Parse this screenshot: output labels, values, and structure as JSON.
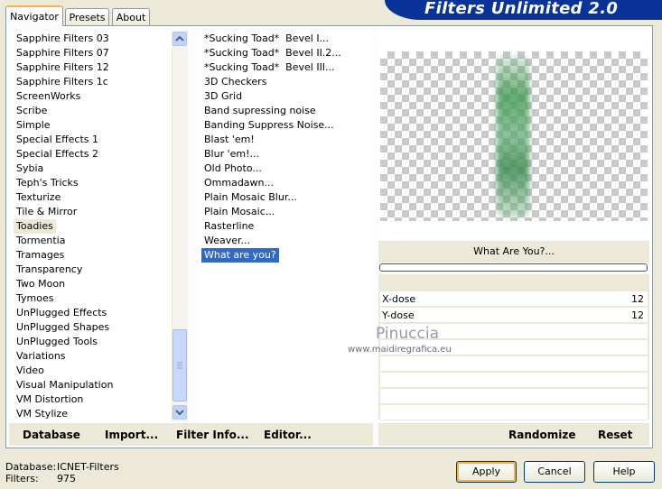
{
  "tabs": [
    "Navigator",
    "Presets",
    "About"
  ],
  "app_title": "Filters Unlimited 2.0",
  "categories": [
    "Sapphire Filters 03",
    "Sapphire Filters 07",
    "Sapphire Filters 12",
    "Sapphire Filters 1c",
    "ScreenWorks",
    "Scribe",
    "Simple",
    "Special Effects 1",
    "Special Effects 2",
    "Sybia",
    "Teph's Tricks",
    "Texturize",
    "Tile & Mirror",
    "Toadies",
    "Tormentia",
    "Tramages",
    "Transparency",
    "Two Moon",
    "Tymoes",
    "UnPlugged Effects",
    "UnPlugged Shapes",
    "UnPlugged Tools",
    "Variations",
    "Video",
    "Visual Manipulation",
    "VM Distortion",
    "VM Stylize"
  ],
  "selected_category": "Toadies",
  "filters": [
    "*Sucking Toad*  Bevel I...",
    "*Sucking Toad*  Bevel II.2...",
    "*Sucking Toad*  Bevel III...",
    "3D Checkers",
    "3D Grid",
    "Band supressing noise",
    "Banding Suppress Noise...",
    "Blast 'em!",
    "Blur 'em!...",
    "Old Photo...",
    "Ommadawn...",
    "Plain Mosaic Blur...",
    "Plain Mosaic...",
    "Rasterline",
    "Weaver...",
    "What are you?"
  ],
  "selected_filter": "What are you?",
  "filter_name": "What Are You?...",
  "params": [
    {
      "label": "X-dose",
      "value": "12"
    },
    {
      "label": "Y-dose",
      "value": "12"
    }
  ],
  "left_buttons": {
    "database": "Database",
    "import": "Import...",
    "filter_info": "Filter Info...",
    "editor": "Editor..."
  },
  "right_buttons": {
    "randomize": "Randomize",
    "reset": "Reset"
  },
  "status": {
    "database_label": "Database:",
    "database_value": "ICNET-Filters",
    "filters_label": "Filters:",
    "filters_value": "975"
  },
  "dialog_buttons": {
    "apply": "Apply",
    "cancel": "Cancel",
    "help": "Help"
  },
  "watermark": {
    "name": "Pinuccia",
    "site": "www.maidiregrafica.eu"
  },
  "colors": {
    "selection": "#316ac5",
    "banner": "#0a3399",
    "preview_stroke": "#5aaa6e"
  }
}
